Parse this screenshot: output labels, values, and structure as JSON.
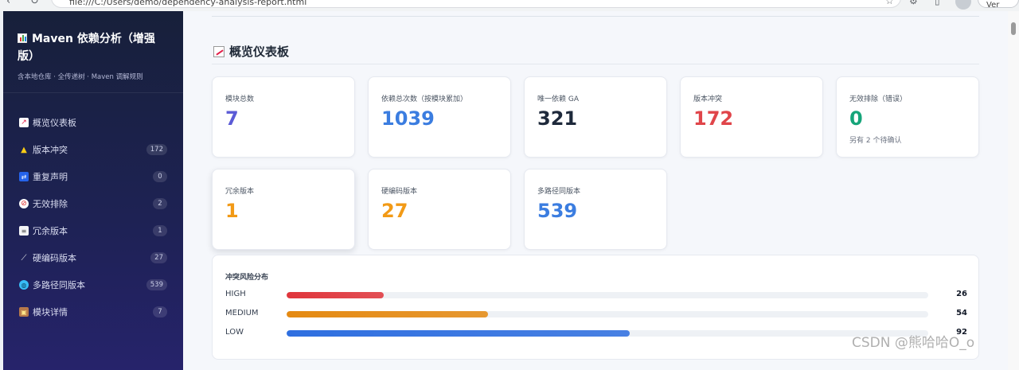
{
  "browser": {
    "address": "file:///C:/Users/demo/dependency-analysis-report.html",
    "profile_label": "Ver"
  },
  "sidebar": {
    "title": "Maven 依赖分析（增强版）",
    "subtitle": "含本地仓库 · 全传递树 · Maven 调解规则",
    "items": [
      {
        "label": "概览仪表板",
        "icon": "chart-icon"
      },
      {
        "label": "版本冲突",
        "icon": "warning-icon",
        "count": "172"
      },
      {
        "label": "重复声明",
        "icon": "repeat-icon",
        "count": "0"
      },
      {
        "label": "无效排除",
        "icon": "prohibited-icon",
        "count": "2"
      },
      {
        "label": "冗余版本",
        "icon": "memo-icon",
        "count": "1"
      },
      {
        "label": "硬编码版本",
        "icon": "wand-icon",
        "count": "27"
      },
      {
        "label": "多路径同版本",
        "icon": "globe-icon",
        "count": "539"
      },
      {
        "label": "模块详情",
        "icon": "package-icon",
        "count": "7"
      }
    ]
  },
  "main": {
    "title": "概览仪表板",
    "cards": [
      {
        "label": "模块总数",
        "value": "7",
        "color": "#5b5bd6"
      },
      {
        "label": "依赖总次数（按模块累加）",
        "value": "1039",
        "color": "#3b7de0"
      },
      {
        "label": "唯一依赖 GA",
        "value": "321",
        "color": "#1e293b"
      },
      {
        "label": "版本冲突",
        "value": "172",
        "color": "#e0454a"
      },
      {
        "label": "无效排除（错误）",
        "value": "0",
        "color": "#16a57a",
        "note": "另有 2 个待确认"
      },
      {
        "label": "冗余版本",
        "value": "1",
        "color": "#f29a16"
      },
      {
        "label": "硬编码版本",
        "value": "27",
        "color": "#f29a16"
      },
      {
        "label": "多路径同版本",
        "value": "539",
        "color": "#3b7de0"
      }
    ],
    "risk": {
      "title": "冲突风险分布",
      "rows": [
        {
          "label": "HIGH",
          "value": "26",
          "fraction": 0.151,
          "color": "#e0363c"
        },
        {
          "label": "MEDIUM",
          "value": "54",
          "fraction": 0.314,
          "color": "#e58a12"
        },
        {
          "label": "LOW",
          "value": "92",
          "fraction": 0.535,
          "color": "#2f6fe0"
        }
      ]
    }
  },
  "watermark": "CSDN @熊哈哈O_o"
}
